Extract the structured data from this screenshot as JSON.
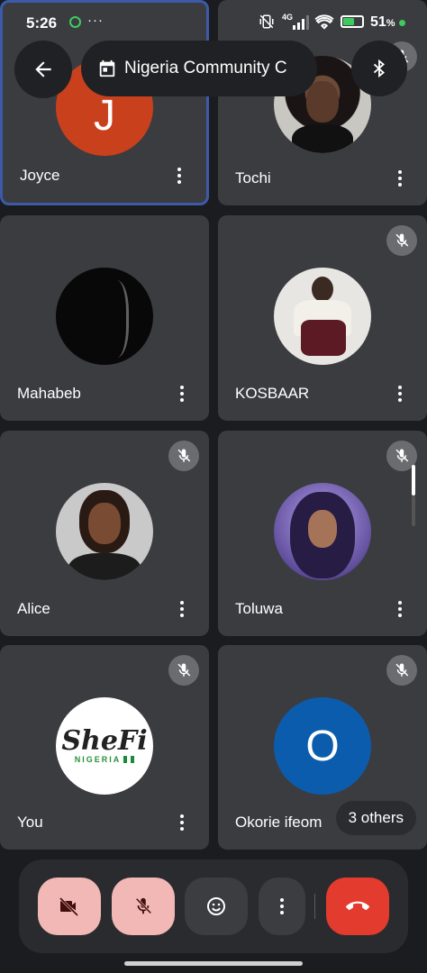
{
  "status_bar": {
    "time": "5:26",
    "network": "4G",
    "battery": "51"
  },
  "header": {
    "meeting_title": "Nigeria Community C"
  },
  "participants": [
    {
      "name": "Joyce",
      "initial": "J",
      "color": "#c9401d",
      "active": true
    },
    {
      "name": "Tochi"
    },
    {
      "name": "Mahabeb"
    },
    {
      "name": "KOSBAAR"
    },
    {
      "name": "Alice"
    },
    {
      "name": "Toluwa"
    },
    {
      "name": "You",
      "logo_text": "SheFi",
      "logo_sub": "NIGERIA"
    },
    {
      "name": "Okorie ifeom",
      "initial": "O",
      "color": "#0c5cad"
    }
  ],
  "others_badge": "3 others",
  "colors": {
    "end_call": "#e33b2e",
    "muted_control": "#f2b8b5",
    "tile_bg": "#3b3c40"
  }
}
